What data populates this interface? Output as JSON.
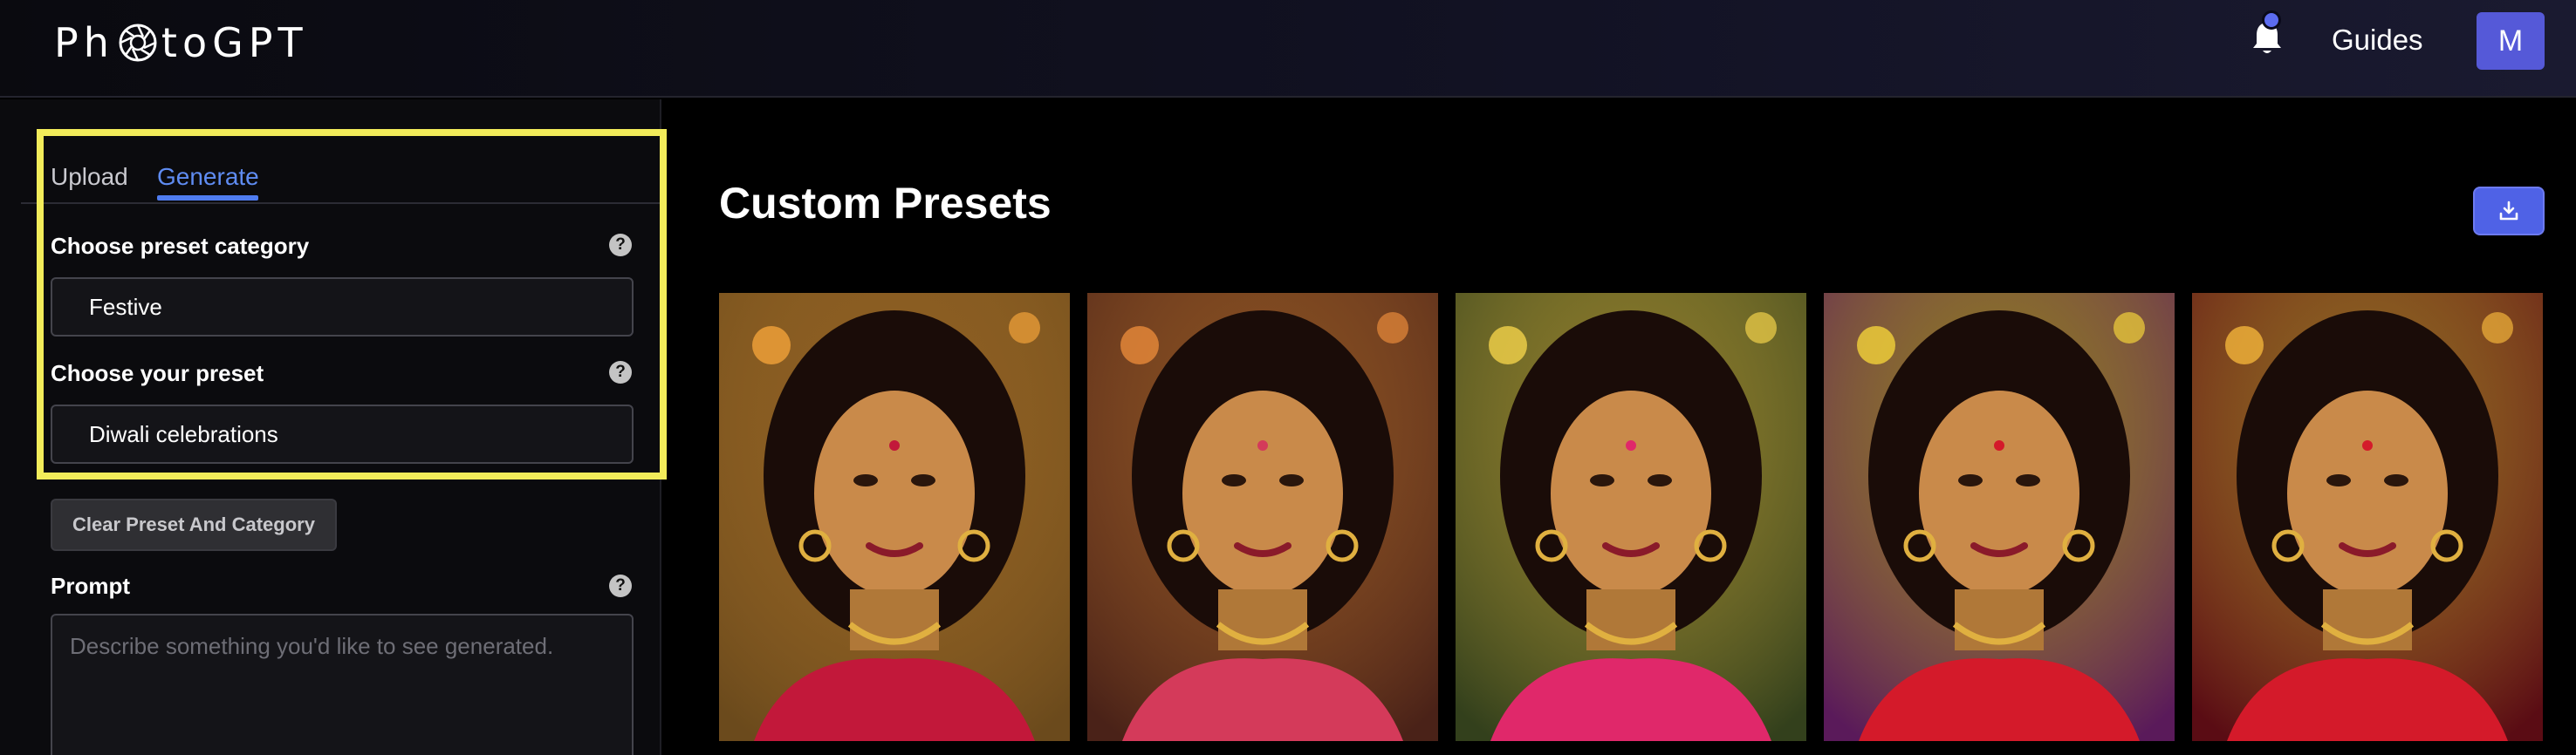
{
  "header": {
    "logo_text_start": "Ph",
    "logo_text_end": "toGPT",
    "logo_icon": "aperture-icon",
    "notifications_icon": "bell-icon",
    "guides_label": "Guides",
    "avatar_initial": "M"
  },
  "sidebar": {
    "tabs": [
      {
        "label": "Upload",
        "active": false
      },
      {
        "label": "Generate",
        "active": true
      }
    ],
    "category_label": "Choose preset category",
    "category_value": "Festive",
    "preset_label": "Choose your preset",
    "preset_value": "Diwali celebrations",
    "help_glyph": "?",
    "clear_button_label": "Clear Preset And Category",
    "prompt_label": "Prompt",
    "prompt_placeholder": "Describe something you'd like to see generated."
  },
  "main": {
    "title": "Custom Presets",
    "download_icon": "download-icon",
    "photos": [
      {
        "bg": "#6b4a1c",
        "glow": "#f2a23a",
        "accent": "#c2183a"
      },
      {
        "bg": "#4a2218",
        "glow": "#e88a3a",
        "accent": "#d43a5a"
      },
      {
        "bg": "#33401c",
        "glow": "#f2d24a",
        "accent": "#e0286a"
      },
      {
        "bg": "#5a1a5a",
        "glow": "#f2d23a",
        "accent": "#d41a2a"
      },
      {
        "bg": "#5a0c14",
        "glow": "#f2b43a",
        "accent": "#d41a2a"
      }
    ]
  },
  "colors": {
    "accent_blue": "#4f7cf0",
    "highlight_yellow": "#f2ec5a",
    "avatar_bg": "#5559d8"
  }
}
